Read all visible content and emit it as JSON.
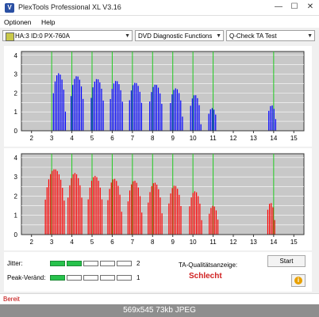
{
  "window": {
    "title": "PlexTools Professional XL V3.16",
    "icon_letter": "V",
    "minimize": "—",
    "maximize": "☐",
    "close": "✕"
  },
  "menu": {
    "items": [
      "Optionen",
      "Help"
    ]
  },
  "toolbar": {
    "drive": "HA:3 ID:0  PX-760A",
    "function": "DVD Diagnostic Functions",
    "test": "Q-Check TA Test"
  },
  "chart_data": [
    {
      "type": "bar",
      "color": "#0000ff",
      "ylim": [
        0,
        4.2
      ],
      "yticks": [
        "0",
        "0.5",
        "1",
        "1.5",
        "2",
        "2.5",
        "3",
        "3.5",
        "4"
      ],
      "xticks": [
        "2",
        "3",
        "4",
        "5",
        "6",
        "7",
        "8",
        "9",
        "10",
        "11",
        "12",
        "13",
        "14",
        "15"
      ],
      "xlim": [
        1.5,
        15.5
      ],
      "gridline_x": [
        3,
        4,
        5,
        6,
        7,
        8,
        9,
        10,
        11,
        14
      ],
      "peaks": [
        {
          "center": 3.35,
          "width": 0.7,
          "height": 3.05
        },
        {
          "center": 4.25,
          "width": 0.75,
          "height": 2.9
        },
        {
          "center": 5.25,
          "width": 0.75,
          "height": 2.75
        },
        {
          "center": 6.2,
          "width": 0.75,
          "height": 2.65
        },
        {
          "center": 7.15,
          "width": 0.75,
          "height": 2.55
        },
        {
          "center": 8.15,
          "width": 0.75,
          "height": 2.45
        },
        {
          "center": 9.15,
          "width": 0.7,
          "height": 2.25
        },
        {
          "center": 10.1,
          "width": 0.6,
          "height": 1.9
        },
        {
          "center": 10.95,
          "width": 0.5,
          "height": 1.2
        },
        {
          "center": 13.9,
          "width": 0.45,
          "height": 1.35
        }
      ]
    },
    {
      "type": "bar",
      "color": "#ff0000",
      "ylim": [
        0,
        4.2
      ],
      "yticks": [
        "0",
        "0.5",
        "1",
        "1.5",
        "2",
        "2.5",
        "3",
        "3.5",
        "4"
      ],
      "xticks": [
        "2",
        "3",
        "4",
        "5",
        "6",
        "7",
        "8",
        "9",
        "10",
        "11",
        "12",
        "13",
        "14",
        "15"
      ],
      "xlim": [
        1.5,
        15.5
      ],
      "gridline_x": [
        3,
        4,
        5,
        6,
        7,
        8,
        9,
        10,
        11,
        14
      ],
      "peaks": [
        {
          "center": 3.15,
          "width": 1.1,
          "height": 3.4
        },
        {
          "center": 4.15,
          "width": 0.85,
          "height": 3.2
        },
        {
          "center": 5.15,
          "width": 0.85,
          "height": 3.05
        },
        {
          "center": 6.1,
          "width": 0.8,
          "height": 2.9
        },
        {
          "center": 7.1,
          "width": 0.8,
          "height": 2.8
        },
        {
          "center": 8.1,
          "width": 0.8,
          "height": 2.7
        },
        {
          "center": 9.1,
          "width": 0.75,
          "height": 2.55
        },
        {
          "center": 10.1,
          "width": 0.7,
          "height": 2.25
        },
        {
          "center": 11.0,
          "width": 0.55,
          "height": 1.5
        },
        {
          "center": 13.85,
          "width": 0.45,
          "height": 1.65
        }
      ]
    }
  ],
  "quality": {
    "jitter_label": "Jitter:",
    "jitter_value": "2",
    "jitter_level": 2,
    "peak_label": "Peak-Veränd:",
    "peak_value": "1",
    "peak_level": 1,
    "segments": 5,
    "ta_label": "TA-Qualitätsanzeige:",
    "ta_result": "Schlecht",
    "ta_result_color": "#d02020",
    "start_label": "Start",
    "info_icon": "i"
  },
  "statusbar": {
    "text": "Bereit"
  },
  "footer": {
    "text": "569x545  73kb  JPEG"
  }
}
